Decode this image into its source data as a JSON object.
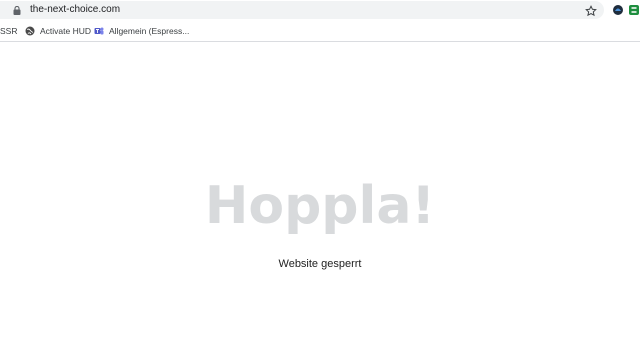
{
  "browser": {
    "url": "the-next-choice.com",
    "icons": {
      "lock": "lock-icon",
      "star": "star-icon",
      "extension_1": "extension-icon",
      "extension_2": "extension-icon"
    },
    "omnibox_color": "#f1f3f4"
  },
  "bookmarks": [
    {
      "label": "SSR",
      "icon": "folder-icon"
    },
    {
      "label": "Activate HUD",
      "icon": "globe-icon"
    },
    {
      "label": "Allgemein (Espress...",
      "icon": "teams-icon"
    }
  ],
  "page": {
    "headline": "Hoppla!",
    "message": "Website gesperrt",
    "headline_color": "#d8dadc"
  }
}
